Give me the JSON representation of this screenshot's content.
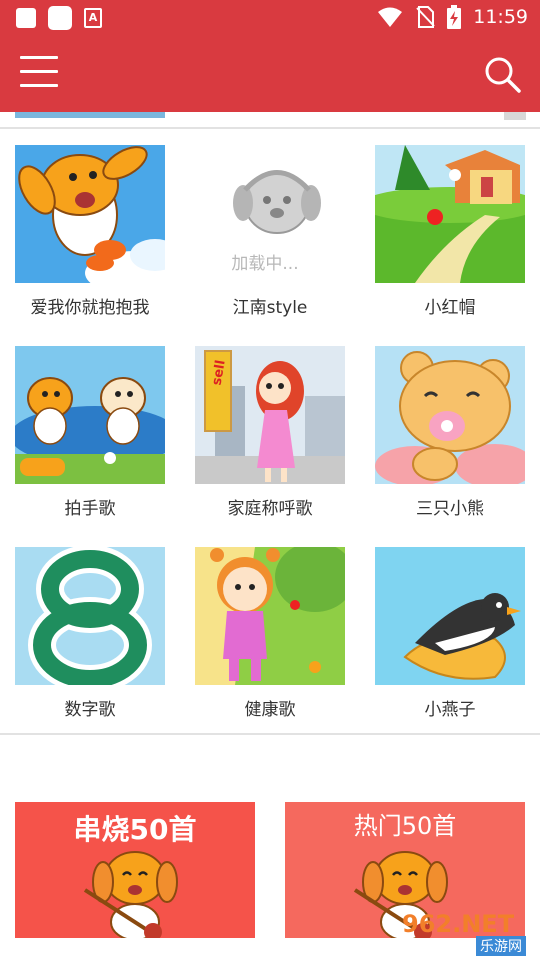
{
  "status_bar": {
    "time": "11:59",
    "a_label": "A"
  },
  "toolbar": {
    "menu_icon": "menu-icon",
    "search_icon": "search-icon"
  },
  "songs": [
    {
      "title": "爱我你就抱抱我",
      "thumb": "puppy-jumping"
    },
    {
      "title": "江南style",
      "thumb": "loading-placeholder",
      "loading_text": "加载中..."
    },
    {
      "title": "小红帽",
      "thumb": "cottage-path"
    },
    {
      "title": "拍手歌",
      "thumb": "two-puppies-pond"
    },
    {
      "title": "家庭称呼歌",
      "thumb": "girl-in-city",
      "sign": "sell"
    },
    {
      "title": "三只小熊",
      "thumb": "bear-pacifier"
    },
    {
      "title": "数字歌",
      "thumb": "number-eight"
    },
    {
      "title": "健康歌",
      "thumb": "girl-in-garden"
    },
    {
      "title": "小燕子",
      "thumb": "swallow-bird"
    }
  ],
  "banners": [
    {
      "title": "串烧50首",
      "color": "#f5534a"
    },
    {
      "title": "热门50首",
      "color": "#f5695e"
    }
  ],
  "watermark": {
    "text": "962.NET",
    "sub": "乐游网"
  },
  "colors": {
    "primary": "#d93a40",
    "caption": "#333333"
  }
}
